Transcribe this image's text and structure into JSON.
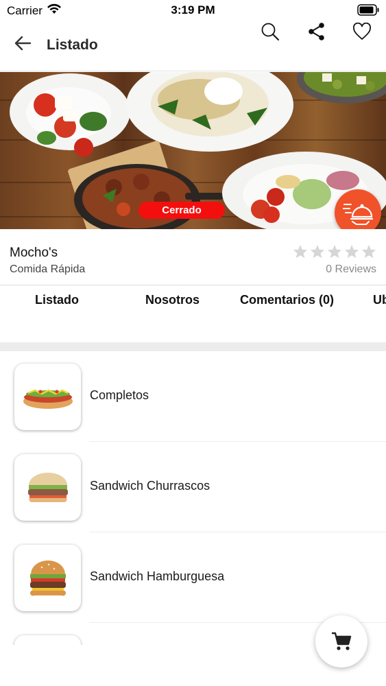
{
  "status_bar": {
    "carrier": "Carrier",
    "time": "3:19 PM"
  },
  "nav": {
    "title": "Listado"
  },
  "hero": {
    "status_badge": "Cerrado"
  },
  "store": {
    "name": "Mocho's",
    "category": "Comida Rápida",
    "rating": 0,
    "max_rating": 5,
    "reviews": "0 Reviews"
  },
  "tabs": [
    "Listado",
    "Nosotros",
    "Comentarios (0)",
    "Ub"
  ],
  "items": [
    {
      "label": "Completos",
      "icon": "hotdog"
    },
    {
      "label": "Sandwich Churrascos",
      "icon": "steak-sandwich"
    },
    {
      "label": "Sandwich Hamburguesa",
      "icon": "burger"
    },
    {
      "label": "",
      "icon": "sandwich"
    }
  ],
  "colors": {
    "accent": "#f0522a",
    "closed": "#f40f0f"
  }
}
